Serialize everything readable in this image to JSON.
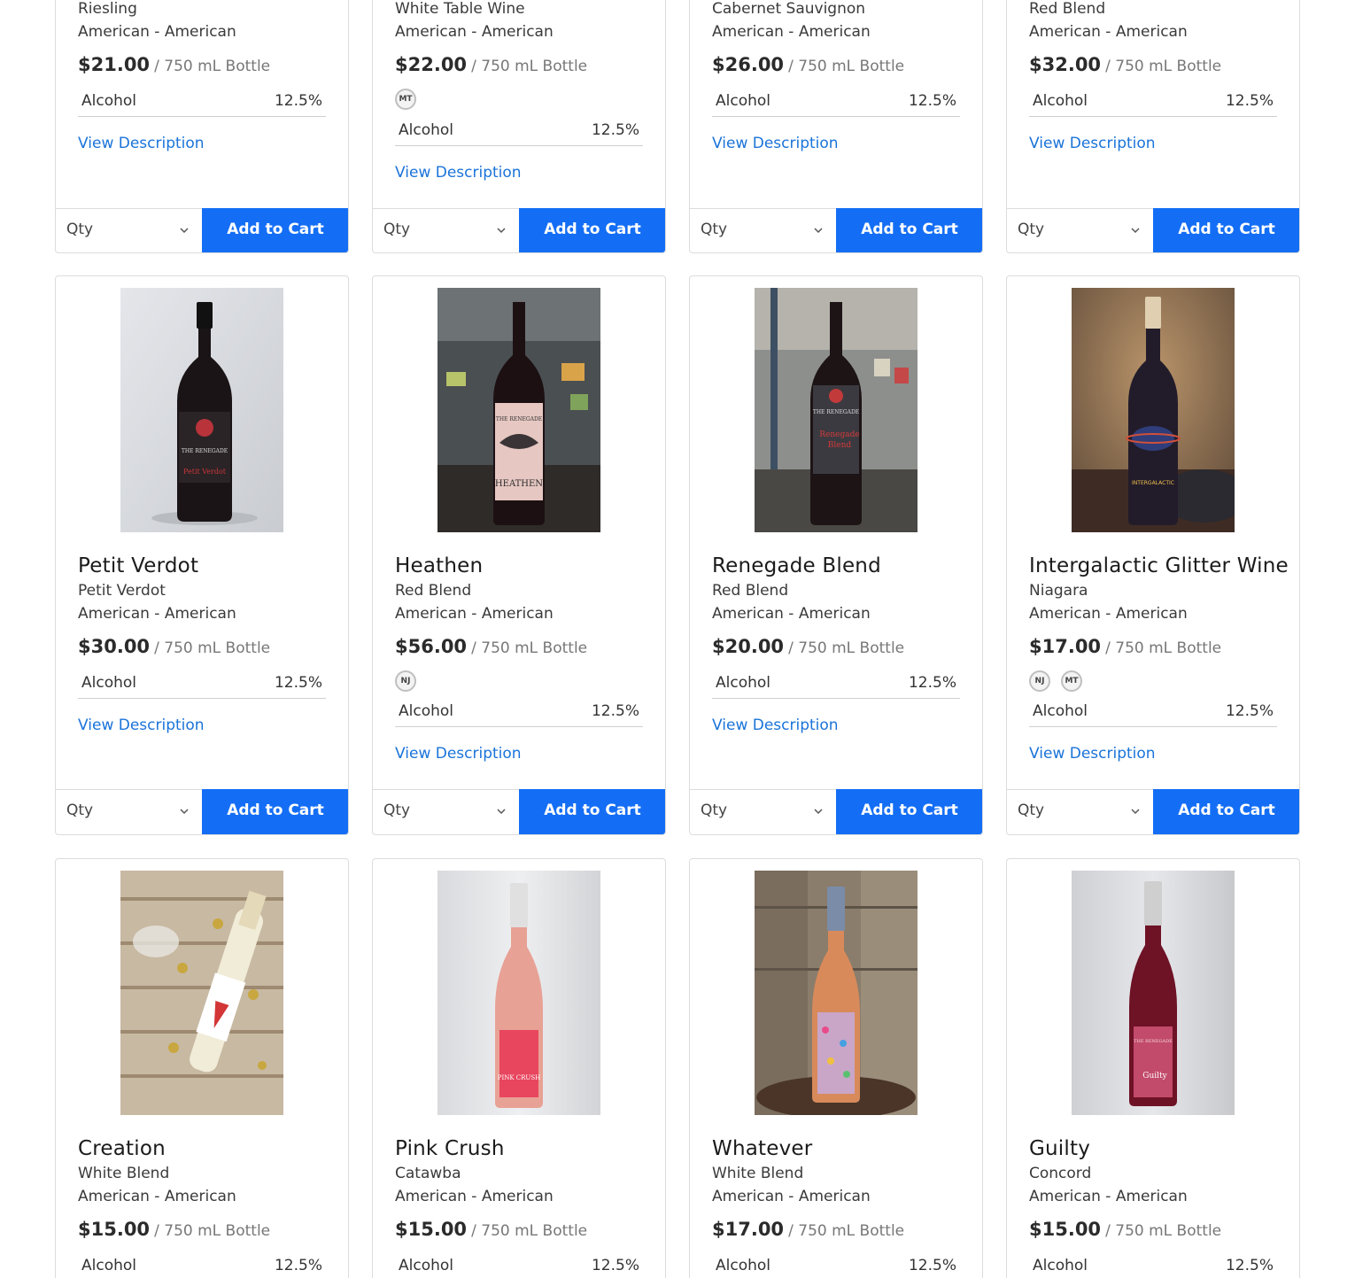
{
  "common": {
    "origin": "American - American",
    "size_label": "/ 750 mL Bottle",
    "spec_key": "Alcohol",
    "spec_val": "12.5%",
    "desc_link": "View Description",
    "qty_placeholder": "Qty",
    "cart_label": "Add to Cart"
  },
  "colors": {
    "accent": "#146ef5",
    "link": "#1a73d9"
  },
  "icons": {
    "qty_dropdown": "chevron-down-icon"
  },
  "row1": [
    {
      "varietal": "Riesling",
      "price": "$21.00",
      "badges": []
    },
    {
      "varietal": "White Table Wine",
      "price": "$22.00",
      "badges": [
        "MT"
      ]
    },
    {
      "varietal": "Cabernet Sauvignon",
      "price": "$26.00",
      "badges": []
    },
    {
      "varietal": "Red Blend",
      "price": "$32.00",
      "badges": []
    }
  ],
  "row2": [
    {
      "name": "Petit Verdot",
      "varietal": "Petit Verdot",
      "price": "$30.00",
      "badges": []
    },
    {
      "name": "Heathen",
      "varietal": "Red Blend",
      "price": "$56.00",
      "badges": [
        "NJ"
      ]
    },
    {
      "name": "Renegade Blend",
      "varietal": "Red Blend",
      "price": "$20.00",
      "badges": []
    },
    {
      "name": "Intergalactic Glitter Wine",
      "varietal": "Niagara",
      "price": "$17.00",
      "badges": [
        "NJ",
        "MT"
      ]
    }
  ],
  "row3": [
    {
      "name": "Creation",
      "varietal": "White Blend",
      "price": "$15.00"
    },
    {
      "name": "Pink Crush",
      "varietal": "Catawba",
      "price": "$15.00"
    },
    {
      "name": "Whatever",
      "varietal": "White Blend",
      "price": "$17.00"
    },
    {
      "name": "Guilty",
      "varietal": "Concord",
      "price": "$15.00"
    }
  ]
}
